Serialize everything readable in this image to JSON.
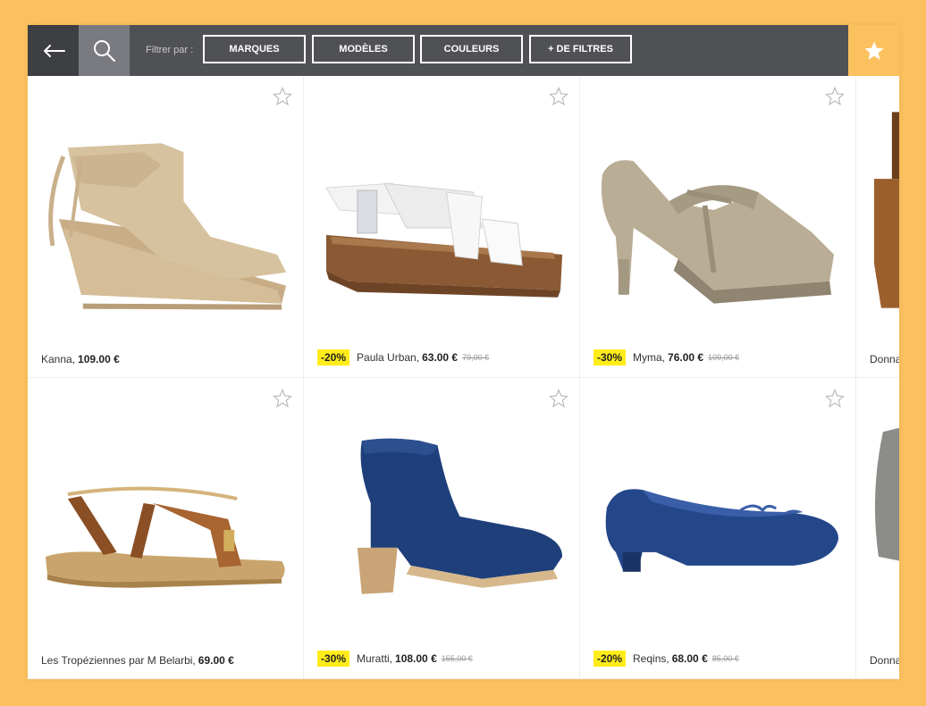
{
  "toolbar": {
    "filter_label": "Filtrer par :",
    "filters": [
      "MARQUES",
      "MODÈLES",
      "COULEURS",
      "+ DE FILTRES"
    ],
    "back_icon": "arrow-left-icon",
    "search_icon": "search-icon",
    "favorites_icon": "star-icon"
  },
  "colors": {
    "background": "#fcc15f",
    "toolbar": "#505155",
    "accent": "#fcc15f",
    "badge": "#ffec1a"
  },
  "products": [
    {
      "name": "Kanna,",
      "price": "109.00 €",
      "discount": "",
      "old_price": ""
    },
    {
      "name": "Paula Urban,",
      "price": "63.00 €",
      "discount": "-20%",
      "old_price": "79,00 €"
    },
    {
      "name": "Myma,",
      "price": "76.00 €",
      "discount": "-30%",
      "old_price": "109,00 €"
    },
    {
      "name": "Donna",
      "price": "",
      "discount": "",
      "old_price": ""
    },
    {
      "name": "Les Tropéziennes par M Belarbi,",
      "price": "69.00 €",
      "discount": "",
      "old_price": ""
    },
    {
      "name": "Muratti,",
      "price": "108.00 €",
      "discount": "-30%",
      "old_price": "155,00 €"
    },
    {
      "name": "Reqins,",
      "price": "68.00 €",
      "discount": "-20%",
      "old_price": "85,00 €"
    },
    {
      "name": "Donna",
      "price": "",
      "discount": "",
      "old_price": ""
    }
  ]
}
